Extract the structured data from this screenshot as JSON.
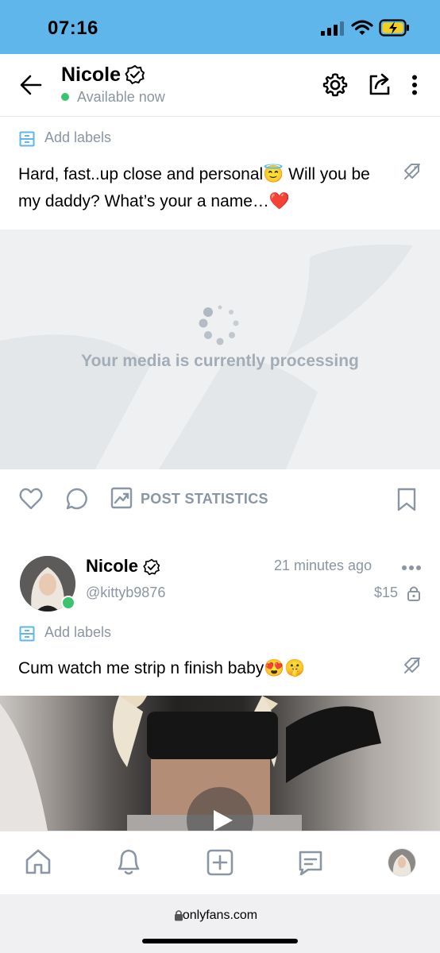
{
  "status_bar": {
    "time": "07:16"
  },
  "header": {
    "name": "Nicole",
    "availability": "Available now",
    "icons": [
      "back-arrow-icon",
      "verified-icon",
      "settings-gear-icon",
      "share-icon",
      "more-vertical-icon"
    ]
  },
  "post1": {
    "add_labels": "Add labels",
    "text": "Hard, fast..up close and personal😇 Will you be my daddy? What’s your a name…❤️",
    "media_message": "Your media is currently processing",
    "post_statistics": "POST STATISTICS"
  },
  "post2": {
    "name": "Nicole",
    "handle": "@kittyb9876",
    "time_ago": "21 minutes ago",
    "price": "$15",
    "add_labels": "Add labels",
    "text": "Cum watch me strip n finish baby😍🤫"
  },
  "tab_bar": {
    "icons": [
      "home-icon",
      "notifications-bell-icon",
      "add-post-icon",
      "messages-icon",
      "profile-avatar"
    ]
  },
  "browser": {
    "url": "onlyfans.com"
  },
  "colors": {
    "accent_blue": "#5eb6ea",
    "status_green": "#3bc46d",
    "muted_text": "#8a96a3",
    "heart_red": "#e0245e"
  }
}
